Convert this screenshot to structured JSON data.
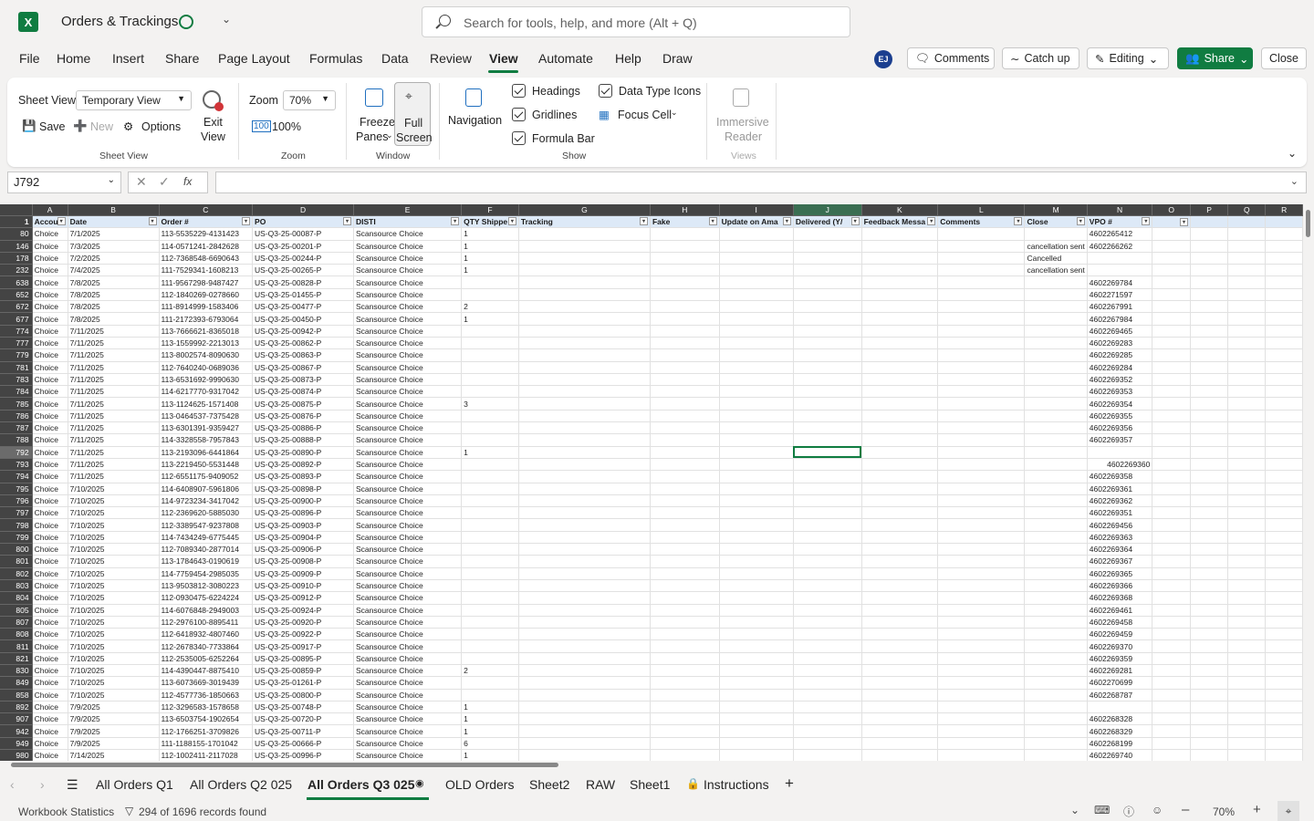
{
  "title": {
    "doc_name": "Orders & Trackings",
    "search_placeholder": "Search for tools, help, and more (Alt + Q)"
  },
  "menu": {
    "items": [
      "File",
      "Home",
      "Insert",
      "Share",
      "Page Layout",
      "Formulas",
      "Data",
      "Review",
      "View",
      "Automate",
      "Help",
      "Draw"
    ],
    "avatar": "EJ",
    "comments": "Comments",
    "catch_up": "Catch up",
    "editing": "Editing",
    "share": "Share",
    "close": "Close"
  },
  "ribbon": {
    "sheet_view_label": "Sheet View",
    "sheet_view_value": "Temporary View",
    "save": "Save",
    "new": "New",
    "options": "Options",
    "exit_view_1": "Exit",
    "exit_view_2": "View",
    "group_sheet_view": "Sheet View",
    "zoom_label": "Zoom",
    "zoom_value": "70%",
    "zoom_100": "100%",
    "group_zoom": "Zoom",
    "freeze_1": "Freeze",
    "freeze_2": "Panes",
    "full_1": "Full",
    "full_2": "Screen",
    "group_window": "Window",
    "navigation": "Navigation",
    "headings": "Headings",
    "gridlines": "Gridlines",
    "formula_bar": "Formula Bar",
    "data_type_icons": "Data Type Icons",
    "focus_cell": "Focus Cell",
    "group_show": "Show",
    "immersive_1": "Immersive",
    "immersive_2": "Reader",
    "group_views": "Views"
  },
  "formula": {
    "name_box": "J792",
    "fx": "fx"
  },
  "columns": [
    "A",
    "B",
    "C",
    "D",
    "E",
    "F",
    "G",
    "H",
    "I",
    "J",
    "K",
    "L",
    "M",
    "N",
    "O",
    "P",
    "Q",
    "R"
  ],
  "headers": [
    "Accou",
    "Date",
    "Order #",
    "PO",
    "DISTI",
    "QTY Shippe",
    "Tracking",
    "Fake",
    "Update on Ama",
    "Delivered (Y/",
    "Feedback Messa",
    "Comments",
    "Close",
    "VPO #",
    "",
    "",
    "",
    ""
  ],
  "header_row_num": "1",
  "rows": [
    [
      "80",
      "Choice",
      "7/1/2025",
      "113-5535229-4131423",
      "US-Q3-25-00087-P",
      "Scansource Choice",
      "1",
      "",
      "",
      "",
      "",
      "",
      "",
      "",
      "4602265412"
    ],
    [
      "146",
      "Choice",
      "7/3/2025",
      "114-0571241-2842628",
      "US-Q3-25-00201-P",
      "Scansource Choice",
      "1",
      "",
      "",
      "",
      "",
      "",
      "cancellation sent",
      "",
      "4602266262"
    ],
    [
      "178",
      "Choice",
      "7/2/2025",
      "112-7368548-6690643",
      "US-Q3-25-00244-P",
      "Scansource Choice",
      "1",
      "",
      "",
      "",
      "",
      "",
      "Cancelled",
      "",
      ""
    ],
    [
      "232",
      "Choice",
      "7/4/2025",
      "111-7529341-1608213",
      "US-Q3-25-00265-P",
      "Scansource Choice",
      "1",
      "",
      "",
      "",
      "",
      "",
      "cancellation sent",
      "",
      ""
    ],
    [
      "638",
      "Choice",
      "7/8/2025",
      "111-9567298-9487427",
      "US-Q3-25-00828-P",
      "Scansource Choice",
      "",
      "",
      "",
      "",
      "",
      "",
      "",
      "",
      "4602269784"
    ],
    [
      "652",
      "Choice",
      "7/8/2025",
      "112-1840269-0278660",
      "US-Q3-25-01455-P",
      "Scansource Choice",
      "",
      "",
      "",
      "",
      "",
      "",
      "",
      "",
      "4602271597"
    ],
    [
      "672",
      "Choice",
      "7/8/2025",
      "111-8914999-1583406",
      "US-Q3-25-00477-P",
      "Scansource Choice",
      "2",
      "",
      "",
      "",
      "",
      "",
      "",
      "",
      "4602267991"
    ],
    [
      "677",
      "Choice",
      "7/8/2025",
      "111-2172393-6793064",
      "US-Q3-25-00450-P",
      "Scansource Choice",
      "1",
      "",
      "",
      "",
      "",
      "",
      "",
      "",
      "4602267984"
    ],
    [
      "774",
      "Choice",
      "7/11/2025",
      "113-7666621-8365018",
      "US-Q3-25-00942-P",
      "Scansource Choice",
      "",
      "",
      "",
      "",
      "",
      "",
      "",
      "",
      "4602269465"
    ],
    [
      "777",
      "Choice",
      "7/11/2025",
      "113-1559992-2213013",
      "US-Q3-25-00862-P",
      "Scansource Choice",
      "",
      "",
      "",
      "",
      "",
      "",
      "",
      "",
      "4602269283"
    ],
    [
      "779",
      "Choice",
      "7/11/2025",
      "113-8002574-8090630",
      "US-Q3-25-00863-P",
      "Scansource Choice",
      "",
      "",
      "",
      "",
      "",
      "",
      "",
      "",
      "4602269285"
    ],
    [
      "781",
      "Choice",
      "7/11/2025",
      "112-7640240-0689036",
      "US-Q3-25-00867-P",
      "Scansource Choice",
      "",
      "",
      "",
      "",
      "",
      "",
      "",
      "",
      "4602269284"
    ],
    [
      "783",
      "Choice",
      "7/11/2025",
      "113-6531692-9990630",
      "US-Q3-25-00873-P",
      "Scansource Choice",
      "",
      "",
      "",
      "",
      "",
      "",
      "",
      "",
      "4602269352"
    ],
    [
      "784",
      "Choice",
      "7/11/2025",
      "114-6217770-9317042",
      "US-Q3-25-00874-P",
      "Scansource Choice",
      "",
      "",
      "",
      "",
      "",
      "",
      "",
      "",
      "4602269353"
    ],
    [
      "785",
      "Choice",
      "7/11/2025",
      "113-1124625-1571408",
      "US-Q3-25-00875-P",
      "Scansource Choice",
      "3",
      "",
      "",
      "",
      "",
      "",
      "",
      "",
      "4602269354"
    ],
    [
      "786",
      "Choice",
      "7/11/2025",
      "113-0464537-7375428",
      "US-Q3-25-00876-P",
      "Scansource Choice",
      "",
      "",
      "",
      "",
      "",
      "",
      "",
      "",
      "4602269355"
    ],
    [
      "787",
      "Choice",
      "7/11/2025",
      "113-6301391-9359427",
      "US-Q3-25-00886-P",
      "Scansource Choice",
      "",
      "",
      "",
      "",
      "",
      "",
      "",
      "",
      "4602269356"
    ],
    [
      "788",
      "Choice",
      "7/11/2025",
      "114-3328558-7957843",
      "US-Q3-25-00888-P",
      "Scansource Choice",
      "",
      "",
      "",
      "",
      "",
      "",
      "",
      "",
      "4602269357"
    ],
    [
      "792",
      "Choice",
      "7/11/2025",
      "113-2193096-6441864",
      "US-Q3-25-00890-P",
      "Scansource Choice",
      "1",
      "",
      "",
      "",
      "",
      "",
      "",
      "",
      ""
    ],
    [
      "793",
      "Choice",
      "7/11/2025",
      "113-2219450-5531448",
      "US-Q3-25-00892-P",
      "Scansource Choice",
      "",
      "",
      "",
      "",
      "",
      "",
      "",
      "",
      "4602269360"
    ],
    [
      "794",
      "Choice",
      "7/11/2025",
      "112-6551175-9409052",
      "US-Q3-25-00893-P",
      "Scansource Choice",
      "",
      "",
      "",
      "",
      "",
      "",
      "",
      "",
      "4602269358"
    ],
    [
      "795",
      "Choice",
      "7/10/2025",
      "114-6408907-5961806",
      "US-Q3-25-00898-P",
      "Scansource Choice",
      "",
      "",
      "",
      "",
      "",
      "",
      "",
      "",
      "4602269361"
    ],
    [
      "796",
      "Choice",
      "7/10/2025",
      "114-9723234-3417042",
      "US-Q3-25-00900-P",
      "Scansource Choice",
      "",
      "",
      "",
      "",
      "",
      "",
      "",
      "",
      "4602269362"
    ],
    [
      "797",
      "Choice",
      "7/10/2025",
      "112-2369620-5885030",
      "US-Q3-25-00896-P",
      "Scansource Choice",
      "",
      "",
      "",
      "",
      "",
      "",
      "",
      "",
      "4602269351"
    ],
    [
      "798",
      "Choice",
      "7/10/2025",
      "112-3389547-9237808",
      "US-Q3-25-00903-P",
      "Scansource Choice",
      "",
      "",
      "",
      "",
      "",
      "",
      "",
      "",
      "4602269456"
    ],
    [
      "799",
      "Choice",
      "7/10/2025",
      "114-7434249-6775445",
      "US-Q3-25-00904-P",
      "Scansource Choice",
      "",
      "",
      "",
      "",
      "",
      "",
      "",
      "",
      "4602269363"
    ],
    [
      "800",
      "Choice",
      "7/10/2025",
      "112-7089340-2877014",
      "US-Q3-25-00906-P",
      "Scansource Choice",
      "",
      "",
      "",
      "",
      "",
      "",
      "",
      "",
      "4602269364"
    ],
    [
      "801",
      "Choice",
      "7/10/2025",
      "113-1784643-0190619",
      "US-Q3-25-00908-P",
      "Scansource Choice",
      "",
      "",
      "",
      "",
      "",
      "",
      "",
      "",
      "4602269367"
    ],
    [
      "802",
      "Choice",
      "7/10/2025",
      "114-7759454-2985035",
      "US-Q3-25-00909-P",
      "Scansource Choice",
      "",
      "",
      "",
      "",
      "",
      "",
      "",
      "",
      "4602269365"
    ],
    [
      "803",
      "Choice",
      "7/10/2025",
      "113-9503812-3080223",
      "US-Q3-25-00910-P",
      "Scansource Choice",
      "",
      "",
      "",
      "",
      "",
      "",
      "",
      "",
      "4602269366"
    ],
    [
      "804",
      "Choice",
      "7/10/2025",
      "112-0930475-6224224",
      "US-Q3-25-00912-P",
      "Scansource Choice",
      "",
      "",
      "",
      "",
      "",
      "",
      "",
      "",
      "4602269368"
    ],
    [
      "805",
      "Choice",
      "7/10/2025",
      "114-6076848-2949003",
      "US-Q3-25-00924-P",
      "Scansource Choice",
      "",
      "",
      "",
      "",
      "",
      "",
      "",
      "",
      "4602269461"
    ],
    [
      "807",
      "Choice",
      "7/10/2025",
      "112-2976100-8895411",
      "US-Q3-25-00920-P",
      "Scansource Choice",
      "",
      "",
      "",
      "",
      "",
      "",
      "",
      "",
      "4602269458"
    ],
    [
      "808",
      "Choice",
      "7/10/2025",
      "112-6418932-4807460",
      "US-Q3-25-00922-P",
      "Scansource Choice",
      "",
      "",
      "",
      "",
      "",
      "",
      "",
      "",
      "4602269459"
    ],
    [
      "811",
      "Choice",
      "7/10/2025",
      "112-2678340-7733864",
      "US-Q3-25-00917-P",
      "Scansource Choice",
      "",
      "",
      "",
      "",
      "",
      "",
      "",
      "",
      "4602269370"
    ],
    [
      "821",
      "Choice",
      "7/10/2025",
      "112-2535005-6252264",
      "US-Q3-25-00895-P",
      "Scansource Choice",
      "",
      "",
      "",
      "",
      "",
      "",
      "",
      "",
      "4602269359"
    ],
    [
      "830",
      "Choice",
      "7/10/2025",
      "114-4390447-8875410",
      "US-Q3-25-00859-P",
      "Scansource Choice",
      "2",
      "",
      "",
      "",
      "",
      "",
      "",
      "",
      "4602269281"
    ],
    [
      "849",
      "Choice",
      "7/10/2025",
      "113-6073669-3019439",
      "US-Q3-25-01261-P",
      "Scansource Choice",
      "",
      "",
      "",
      "",
      "",
      "",
      "",
      "",
      "4602270699"
    ],
    [
      "858",
      "Choice",
      "7/10/2025",
      "112-4577736-1850663",
      "US-Q3-25-00800-P",
      "Scansource Choice",
      "",
      "",
      "",
      "",
      "",
      "",
      "",
      "",
      "4602268787"
    ],
    [
      "892",
      "Choice",
      "7/9/2025",
      "112-3296583-1578658",
      "US-Q3-25-00748-P",
      "Scansource Choice",
      "1",
      "",
      "",
      "",
      "",
      "",
      "",
      "",
      ""
    ],
    [
      "907",
      "Choice",
      "7/9/2025",
      "113-6503754-1902654",
      "US-Q3-25-00720-P",
      "Scansource Choice",
      "1",
      "",
      "",
      "",
      "",
      "",
      "",
      "",
      "4602268328"
    ],
    [
      "942",
      "Choice",
      "7/9/2025",
      "112-1766251-3709826",
      "US-Q3-25-00711-P",
      "Scansource Choice",
      "1",
      "",
      "",
      "",
      "",
      "",
      "",
      "",
      "4602268329"
    ],
    [
      "949",
      "Choice",
      "7/9/2025",
      "111-1188155-1701042",
      "US-Q3-25-00666-P",
      "Scansource Choice",
      "6",
      "",
      "",
      "",
      "",
      "",
      "",
      "",
      "4602268199"
    ],
    [
      "980",
      "Choice",
      "7/14/2025",
      "112-1002411-2117028",
      "US-Q3-25-00996-P",
      "Scansource Choice",
      "1",
      "",
      "",
      "",
      "",
      "",
      "",
      "",
      "4602269740"
    ]
  ],
  "sheets": [
    "All Orders Q1",
    "All Orders Q2 025",
    "All Orders Q3 025",
    "OLD Orders",
    "Sheet2",
    "RAW",
    "Sheet1",
    "Instructions"
  ],
  "status": {
    "workbook_stats": "Workbook Statistics",
    "records": "294 of 1696 records found",
    "zoom": "70%"
  },
  "colors": {
    "accent": "#107c41",
    "header_fill": "#dde9f7",
    "selected_cell": "#107c41"
  }
}
